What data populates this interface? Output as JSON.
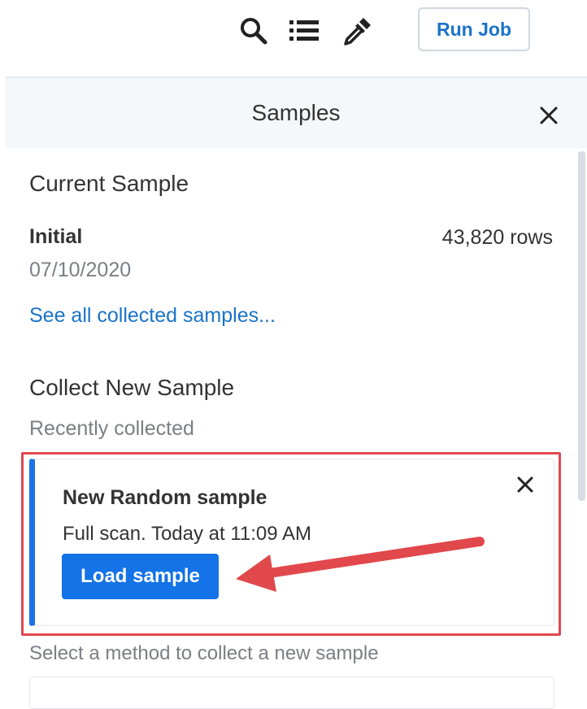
{
  "toolbar": {
    "icons": [
      "search-icon",
      "list-icon",
      "eyedropper-icon"
    ],
    "run_job_label": "Run Job"
  },
  "panel": {
    "title": "Samples",
    "current_sample": {
      "heading": "Current Sample",
      "name": "Initial",
      "rows": "43,820 rows",
      "date": "07/10/2020",
      "see_all_link": "See all collected samples..."
    },
    "collect_new": {
      "heading": "Collect New Sample",
      "recently_collected_label": "Recently collected",
      "card": {
        "title": "New Random sample",
        "description": "Full scan. Today at 11:09 AM",
        "load_label": "Load sample"
      },
      "method_prompt": "Select a method to collect a new sample"
    }
  },
  "colors": {
    "accent": "#1473e6",
    "link": "#1a73c8",
    "highlight": "#e0484c",
    "header_bg": "#f5f8fb"
  }
}
